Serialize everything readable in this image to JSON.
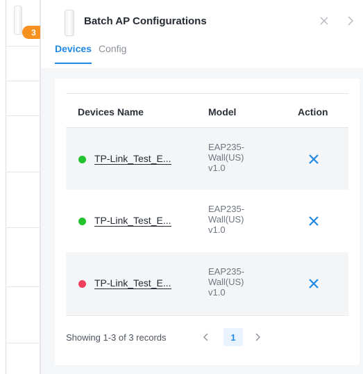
{
  "background": {
    "badge_count": "3"
  },
  "panel": {
    "title": "Batch AP Configurations",
    "tabs": [
      {
        "label": "Devices",
        "active": true
      },
      {
        "label": "Config",
        "active": false
      }
    ],
    "close_icon": "close-icon",
    "next_icon": "chevron-right-icon"
  },
  "table": {
    "headers": {
      "name": "Devices Name",
      "model": "Model",
      "action": "Action"
    },
    "rows": [
      {
        "name": "TP-Link_Test_E...",
        "status": "online",
        "status_color": "#22c32e",
        "model_lines": [
          "EAP235-",
          "Wall(US)",
          "v1.0"
        ]
      },
      {
        "name": "TP-Link_Test_E...",
        "status": "online",
        "status_color": "#22c32e",
        "model_lines": [
          "EAP235-",
          "Wall(US)",
          "v1.0"
        ]
      },
      {
        "name": "TP-Link_Test_E...",
        "status": "offline",
        "status_color": "#ef3f5d",
        "model_lines": [
          "EAP235-",
          "Wall(US)",
          "v1.0"
        ]
      }
    ]
  },
  "pagination": {
    "summary": "Showing 1-3 of 3 records",
    "current_page": "1"
  },
  "colors": {
    "accent": "#1e88e5",
    "badge": "#f6901e"
  }
}
